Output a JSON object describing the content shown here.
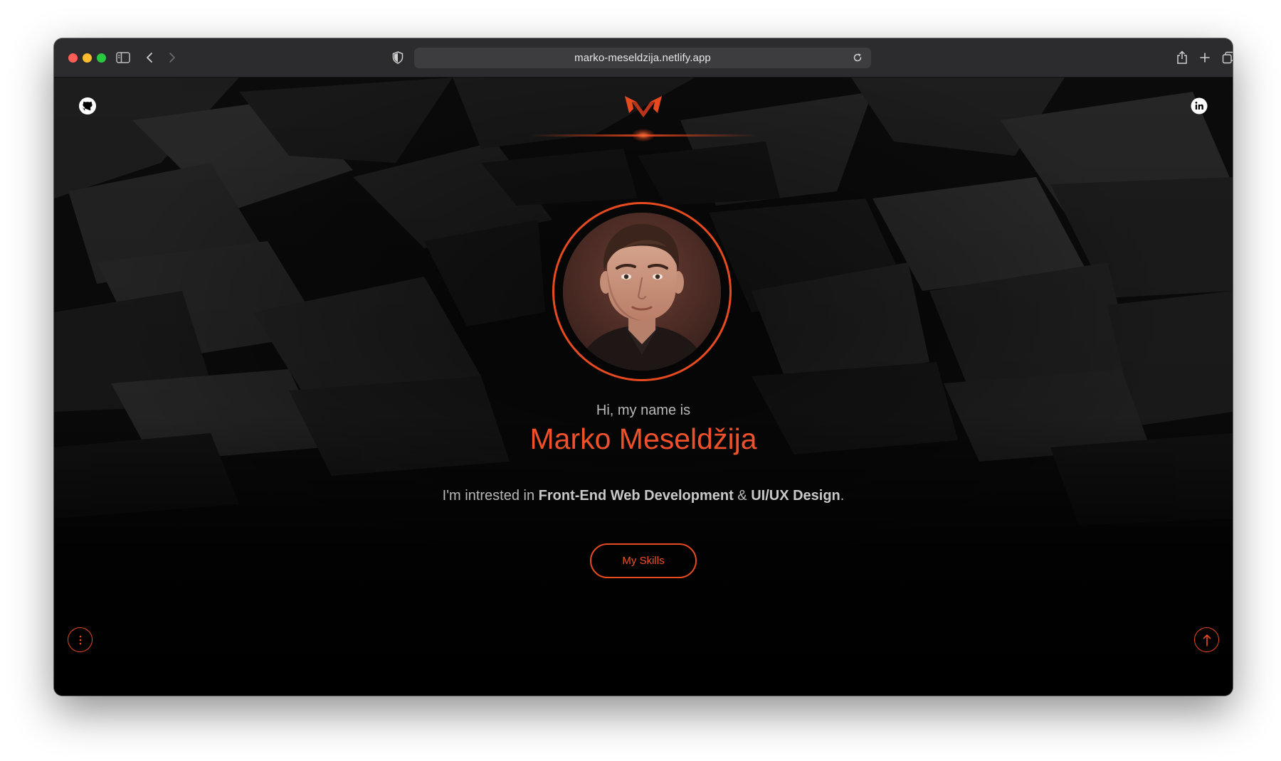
{
  "browser": {
    "url": "marko-meseldzija.netlify.app",
    "accent": "#e84a20"
  },
  "header": {
    "github_icon": "github-icon",
    "linkedin_icon": "linkedin-icon",
    "logo": "M monogram logo"
  },
  "hero": {
    "greeting": "Hi, my name is",
    "name": "Marko Meseldžija",
    "interest_prefix": "I'm intrested in ",
    "interest_strong_1": "Front-End Web Development",
    "interest_join": " & ",
    "interest_strong_2": "UI/UX Design",
    "interest_suffix": ".",
    "cta_label": "My Skills"
  },
  "footer": {
    "menu_icon": "vertical-dots-icon",
    "scroll_top_icon": "arrow-up-icon"
  },
  "colors": {
    "accent": "#e84a20",
    "name_text": "#f0512a",
    "body_text": "#b8b8b8",
    "background": "#000000",
    "titlebar": "#2c2c2e"
  }
}
